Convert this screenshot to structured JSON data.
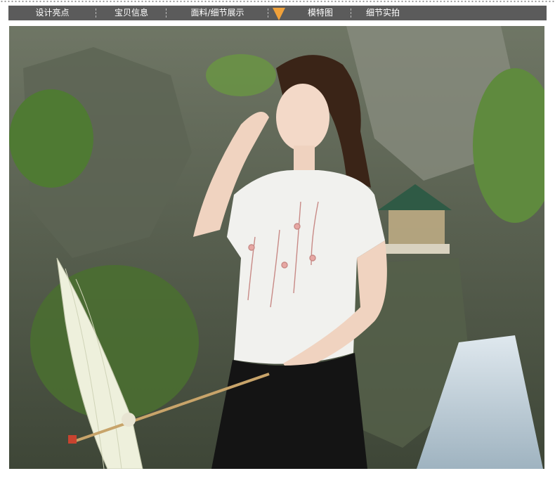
{
  "nav": {
    "items": [
      {
        "label": "设计亮点",
        "active": false
      },
      {
        "label": "宝贝信息",
        "active": false
      },
      {
        "label": "面料/细节展示",
        "active": false
      },
      {
        "label": "模特图",
        "active": true
      },
      {
        "label": "细节实拍",
        "active": false
      }
    ],
    "background_color": "#5b5b5b",
    "active_marker_color": "#f0a13a"
  },
  "photo": {
    "subject": "model-photo",
    "colors": {
      "blouse": "#f1f1ee",
      "skirt": "#141414",
      "foliage": "#5f8a3e",
      "rock": "#6b7260",
      "umbrella": "#eef0dc"
    }
  }
}
